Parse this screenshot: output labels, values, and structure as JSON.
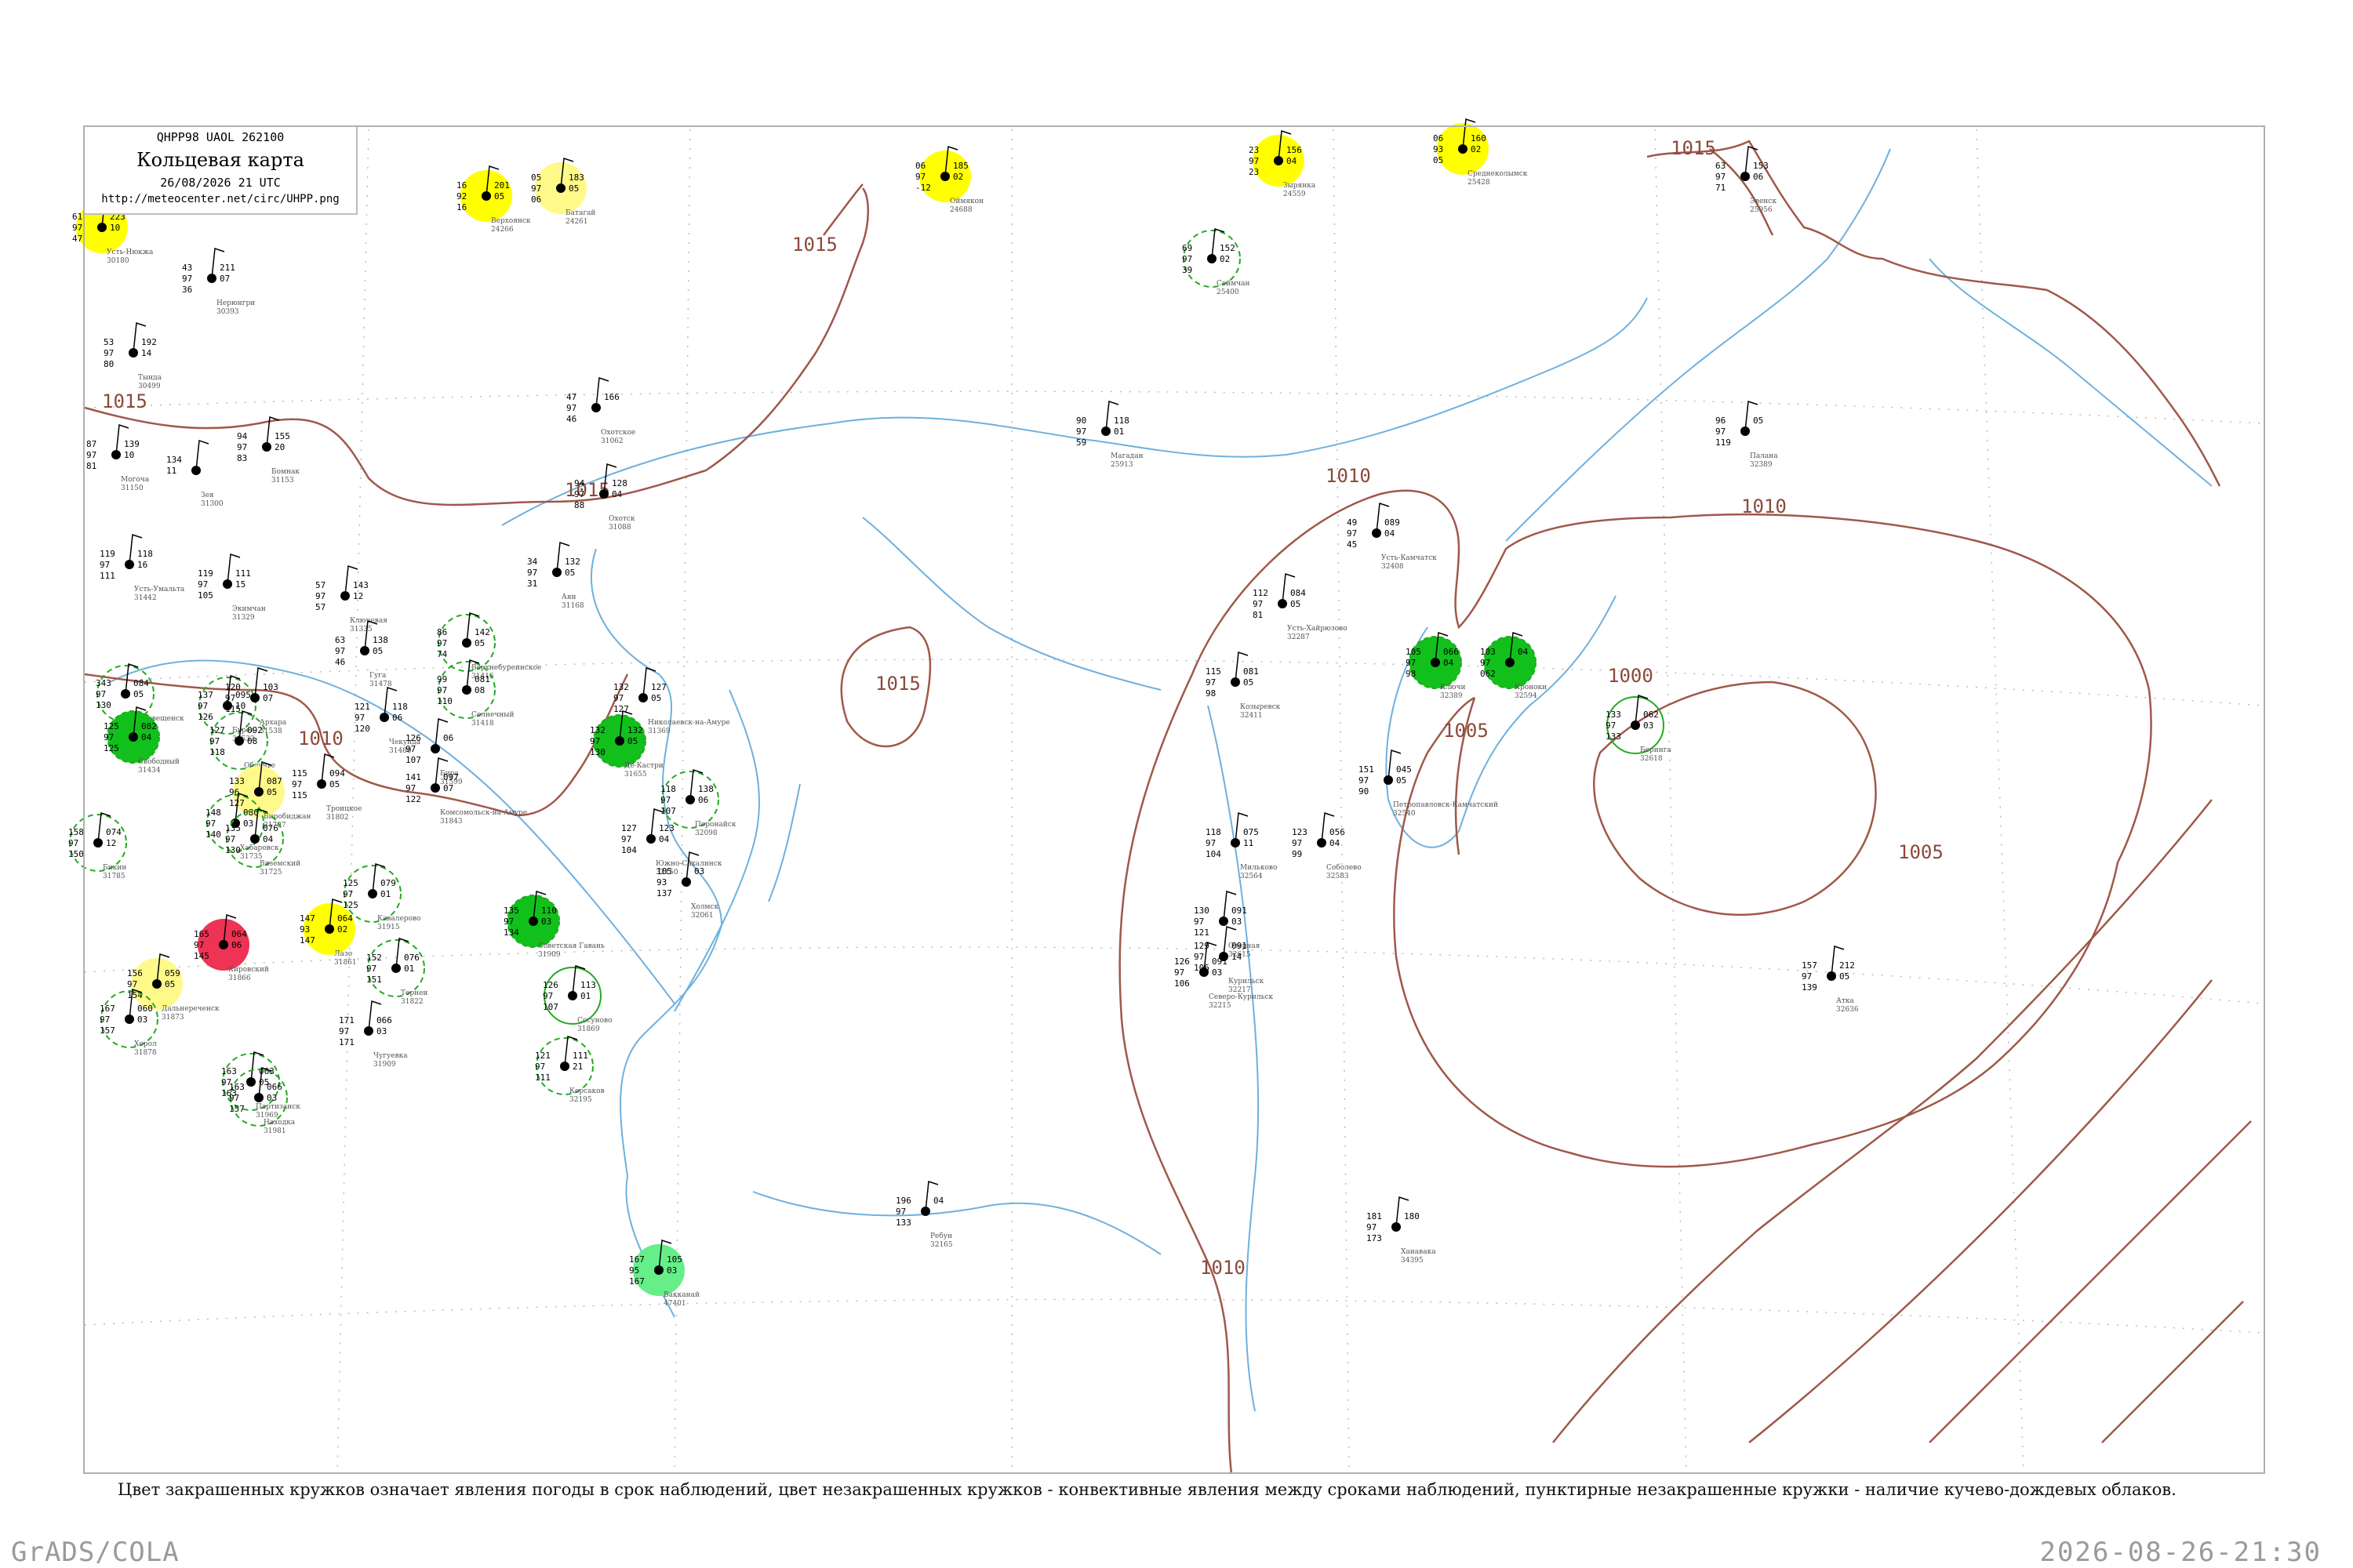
{
  "title": {
    "code": "QHPP98  UAOL  262100",
    "name": "Кольцевая карта",
    "date": "26/08/2026 21 UTC",
    "url": "http://meteocenter.net/circ/UHPP.png"
  },
  "caption": "Цвет закрашенных кружков означает явления погоды в срок наблюдений, цвет незакрашенных кружков - конвективные явления между сроками наблюдений, пунктирные незакрашенные кружки - наличие кучево-дождевых облаков.",
  "footer": {
    "left": "GrADS/COLA",
    "right": "2026-08-26-21:30"
  },
  "colors": {
    "isobar": "#a0584a",
    "coast": "#6fb0de",
    "fog_yellow": "#ffff00",
    "light_yellow": "#fff98a",
    "rain_green": "#11c01b",
    "light_green": "#66ee88",
    "thunder_red": "#ee3355",
    "dashed_green": "#22aa22"
  },
  "isobars": [
    {
      "label": "1015"
    },
    {
      "label": "1015"
    },
    {
      "label": "1015"
    },
    {
      "label": "1015"
    },
    {
      "label": "1015"
    },
    {
      "label": "1010"
    },
    {
      "label": "1010"
    },
    {
      "label": "1010"
    },
    {
      "label": "1010"
    },
    {
      "label": "1005"
    },
    {
      "label": "1005"
    },
    {
      "label": "1000"
    }
  ],
  "stations": [
    {
      "name": "Усть-Нюкжа",
      "id": "30180",
      "vals": [
        "61",
        "97",
        "47",
        "223",
        "10"
      ],
      "style": "fog_yellow"
    },
    {
      "name": "Нерюнгри",
      "id": "30393",
      "vals": [
        "43",
        "97",
        "36",
        "211",
        "07"
      ],
      "style": "none"
    },
    {
      "name": "Тында",
      "id": "30499",
      "vals": [
        "53",
        "97",
        "80",
        "192",
        "14"
      ],
      "style": "none"
    },
    {
      "name": "Могоча",
      "id": "31150",
      "vals": [
        "87",
        "97",
        "81",
        "139",
        "10"
      ],
      "style": "none"
    },
    {
      "name": "Бомнак",
      "id": "31153",
      "vals": [
        "94",
        "97",
        "83",
        "155",
        "20"
      ],
      "style": "none"
    },
    {
      "name": "Зея",
      "id": "31300",
      "vals": [
        "134",
        "11"
      ],
      "style": "none"
    },
    {
      "name": "Усть-Умальта",
      "id": "31442",
      "vals": [
        "119",
        "97",
        "111",
        "118",
        "16"
      ],
      "style": "none"
    },
    {
      "name": "Экимчан",
      "id": "31329",
      "vals": [
        "119",
        "97",
        "105",
        "111",
        "15"
      ],
      "style": "none"
    },
    {
      "name": "Ключевая",
      "id": "31335",
      "vals": [
        "57",
        "97",
        "57",
        "143",
        "12"
      ],
      "style": "none"
    },
    {
      "name": "Гуга",
      "id": "31478",
      "vals": [
        "63",
        "97",
        "46",
        "138",
        "05"
      ],
      "style": "none"
    },
    {
      "name": "Благовещенск",
      "id": "31510",
      "vals": [
        "343",
        "97",
        "130",
        "084",
        "05"
      ],
      "style": "dashed"
    },
    {
      "name": "Бурея",
      "id": "31532",
      "vals": [
        "137",
        "97",
        "126",
        "095",
        "10"
      ],
      "style": "dashed"
    },
    {
      "name": "Архара",
      "id": "31538",
      "vals": [
        "120",
        "97",
        "115",
        "103",
        "07"
      ],
      "style": "none"
    },
    {
      "name": "Свободный",
      "id": "31434",
      "vals": [
        "125",
        "97",
        "125",
        "082",
        "04"
      ],
      "style": "green"
    },
    {
      "name": "Облучье",
      "id": "31594",
      "vals": [
        "127",
        "97",
        "118",
        "092",
        "08"
      ],
      "style": "dashed"
    },
    {
      "name": "Биробиджан",
      "id": "31707",
      "vals": [
        "133",
        "96",
        "127",
        "087",
        "05"
      ],
      "style": "light_yellow"
    },
    {
      "name": "Хабаровск",
      "id": "31735",
      "vals": [
        "148",
        "97",
        "140",
        "080",
        "03"
      ],
      "style": "dashed"
    },
    {
      "name": "Бикин",
      "id": "31785",
      "vals": [
        "158",
        "97",
        "150",
        "074",
        "12"
      ],
      "style": "dashed"
    },
    {
      "name": "Вяземский",
      "id": "31725",
      "vals": [
        "135",
        "97",
        "130",
        "076",
        "04"
      ],
      "style": "dashed"
    },
    {
      "name": "Троицкое",
      "id": "31802",
      "vals": [
        "115",
        "97",
        "115",
        "094",
        "05"
      ],
      "style": "none"
    },
    {
      "name": "Чекунда",
      "id": "31480",
      "vals": [
        "121",
        "97",
        "120",
        "118",
        "06"
      ],
      "style": "none"
    },
    {
      "name": "Бира",
      "id": "31599",
      "vals": [
        "126",
        "97",
        "107",
        "06"
      ],
      "style": "none"
    },
    {
      "name": "Комсомольск-на-Амуре",
      "id": "31843",
      "vals": [
        "141",
        "97",
        "122",
        "097",
        "07"
      ],
      "style": "none"
    },
    {
      "name": "Верхнебуреинское",
      "id": "31416",
      "vals": [
        "86",
        "97",
        "74",
        "142",
        "05"
      ],
      "style": "dashed"
    },
    {
      "name": "Солнечный",
      "id": "31418",
      "vals": [
        "99",
        "97",
        "110",
        "081",
        "08"
      ],
      "style": "dashed"
    },
    {
      "name": "Николаевск-на-Амуре",
      "id": "31369",
      "vals": [
        "132",
        "97",
        "127",
        "127",
        "05"
      ],
      "style": "none"
    },
    {
      "name": "Де-Кастри",
      "id": "31655",
      "vals": [
        "132",
        "97",
        "130",
        "132",
        "05"
      ],
      "style": "green"
    },
    {
      "name": "Советская Гавань",
      "id": "31909",
      "vals": [
        "135",
        "97",
        "134",
        "110",
        "03"
      ],
      "style": "green"
    },
    {
      "name": "Поронайск",
      "id": "32098",
      "vals": [
        "118",
        "97",
        "107",
        "138",
        "06"
      ],
      "style": "dashed"
    },
    {
      "name": "Южно-Сахалинск",
      "id": "32150",
      "vals": [
        "127",
        "97",
        "104",
        "123",
        "04"
      ],
      "style": "none"
    },
    {
      "name": "Холмск",
      "id": "32061",
      "vals": [
        "105",
        "93",
        "137",
        "03"
      ],
      "style": "none"
    },
    {
      "name": "Лазо",
      "id": "31861",
      "vals": [
        "147",
        "93",
        "147",
        "064",
        "02"
      ],
      "style": "fog_yellow"
    },
    {
      "name": "Дальнереченск",
      "id": "31873",
      "vals": [
        "156",
        "97",
        "154",
        "059",
        "05"
      ],
      "style": "light_yellow"
    },
    {
      "name": "Хорол",
      "id": "31878",
      "vals": [
        "167",
        "97",
        "157",
        "060",
        "03"
      ],
      "style": "dashed"
    },
    {
      "name": "Кировский",
      "id": "31866",
      "vals": [
        "165",
        "97",
        "145",
        "064",
        "06"
      ],
      "style": "red"
    },
    {
      "name": "Чугуевка",
      "id": "31909",
      "vals": [
        "171",
        "97",
        "171",
        "066",
        "03"
      ],
      "style": "none"
    },
    {
      "name": "Партизанск",
      "id": "31969",
      "vals": [
        "163",
        "97",
        "163",
        "063",
        "05"
      ],
      "style": "dashed"
    },
    {
      "name": "Находка",
      "id": "31981",
      "vals": [
        "163",
        "97",
        "157",
        "066",
        "03"
      ],
      "style": "dashed"
    },
    {
      "name": "Тернеи",
      "id": "31822",
      "vals": [
        "152",
        "97",
        "151",
        "076",
        "01"
      ],
      "style": "dashed"
    },
    {
      "name": "Кавалерово",
      "id": "31915",
      "vals": [
        "125",
        "97",
        "125",
        "079",
        "01"
      ],
      "style": "dashed"
    },
    {
      "name": "Сосуново",
      "id": "31869",
      "vals": [
        "126",
        "97",
        "107",
        "113",
        "01"
      ],
      "style": "green_ring"
    },
    {
      "name": "Корсаков",
      "id": "32195",
      "vals": [
        "121",
        "97",
        "111",
        "111",
        "21"
      ],
      "style": "dashed"
    },
    {
      "name": "Вакканай",
      "id": "47401",
      "vals": [
        "167",
        "95",
        "167",
        "105",
        "03"
      ],
      "style": "light_green"
    },
    {
      "name": "Ребун",
      "id": "32165",
      "vals": [
        "196",
        "97",
        "133",
        "04"
      ],
      "style": "none"
    },
    {
      "name": "Ханавака",
      "id": "34395",
      "vals": [
        "181",
        "97",
        "173",
        "180"
      ],
      "style": "none"
    },
    {
      "name": "Охотск",
      "id": "31088",
      "vals": [
        "94",
        "97",
        "88",
        "128",
        "04"
      ],
      "style": "none"
    },
    {
      "name": "Аян",
      "id": "31168",
      "vals": [
        "34",
        "97",
        "31",
        "132",
        "05"
      ],
      "style": "none"
    },
    {
      "name": "Магадан",
      "id": "25913",
      "vals": [
        "90",
        "97",
        "59",
        "118",
        "01"
      ],
      "style": "none"
    },
    {
      "name": "Охотское",
      "id": "31062",
      "vals": [
        "47",
        "97",
        "46",
        "166"
      ],
      "style": "none"
    },
    {
      "name": "Сеймчан",
      "id": "25400",
      "vals": [
        "69",
        "97",
        "39",
        "152",
        "02"
      ],
      "style": "dashed"
    },
    {
      "name": "Верхоянск",
      "id": "24266",
      "vals": [
        "16",
        "92",
        "16",
        "201",
        "05"
      ],
      "style": "fog_yellow"
    },
    {
      "name": "Батагай",
      "id": "24261",
      "vals": [
        "05",
        "97",
        "06",
        "183",
        "05"
      ],
      "style": "light_yellow"
    },
    {
      "name": "Оймякон",
      "id": "24688",
      "vals": [
        "06",
        "97",
        "-12",
        "185",
        "02"
      ],
      "style": "fog_yellow"
    },
    {
      "name": "Зырянка",
      "id": "24559",
      "vals": [
        "23",
        "97",
        "23",
        "156",
        "04"
      ],
      "style": "fog_yellow"
    },
    {
      "name": "Среднеколымск",
      "id": "25428",
      "vals": [
        "06",
        "93",
        "05",
        "160",
        "02"
      ],
      "style": "fog_yellow"
    },
    {
      "name": "Эвенск",
      "id": "25956",
      "vals": [
        "63",
        "97",
        "71",
        "153",
        "06"
      ],
      "style": "none"
    },
    {
      "name": "Палана",
      "id": "32389",
      "vals": [
        "96",
        "97",
        "119",
        "05"
      ],
      "style": "none"
    },
    {
      "name": "Усть-Камчатск",
      "id": "32408",
      "vals": [
        "49",
        "97",
        "45",
        "089",
        "04"
      ],
      "style": "none"
    },
    {
      "name": "Усть-Хайрюзово",
      "id": "32287",
      "vals": [
        "112",
        "97",
        "81",
        "084",
        "05"
      ],
      "style": "none"
    },
    {
      "name": "Ключи",
      "id": "32389",
      "vals": [
        "105",
        "97",
        "98",
        "066",
        "04"
      ],
      "style": "green"
    },
    {
      "name": "Козыревск",
      "id": "32411",
      "vals": [
        "115",
        "97",
        "98",
        "081",
        "05"
      ],
      "style": "none"
    },
    {
      "name": "Кроноки",
      "id": "32594",
      "vals": [
        "103",
        "97",
        "062",
        "04"
      ],
      "style": "green"
    },
    {
      "name": "Беринга",
      "id": "32618",
      "vals": [
        "133",
        "97",
        "133",
        "062",
        "03"
      ],
      "style": "green_ring"
    },
    {
      "name": "Петропавловск-Камчатский",
      "id": "32540",
      "vals": [
        "151",
        "97",
        "90",
        "045",
        "05"
      ],
      "style": "none"
    },
    {
      "name": "Мильково",
      "id": "32564",
      "vals": [
        "118",
        "97",
        "104",
        "075",
        "11"
      ],
      "style": "none"
    },
    {
      "name": "Соболево",
      "id": "32583",
      "vals": [
        "123",
        "97",
        "99",
        "056",
        "04"
      ],
      "style": "none"
    },
    {
      "name": "Озерная",
      "id": "32615",
      "vals": [
        "130",
        "97",
        "121",
        "091",
        "03"
      ],
      "style": "none"
    },
    {
      "name": "Курильск",
      "id": "32217",
      "vals": [
        "129",
        "97",
        "106",
        "091",
        "14"
      ],
      "style": "none"
    },
    {
      "name": "Северо-Курильск",
      "id": "32215",
      "vals": [
        "126",
        "97",
        "106",
        "091",
        "03"
      ],
      "style": "none"
    },
    {
      "name": "Атка",
      "id": "32636",
      "vals": [
        "157",
        "97",
        "139",
        "212",
        "05"
      ],
      "style": "none"
    }
  ]
}
